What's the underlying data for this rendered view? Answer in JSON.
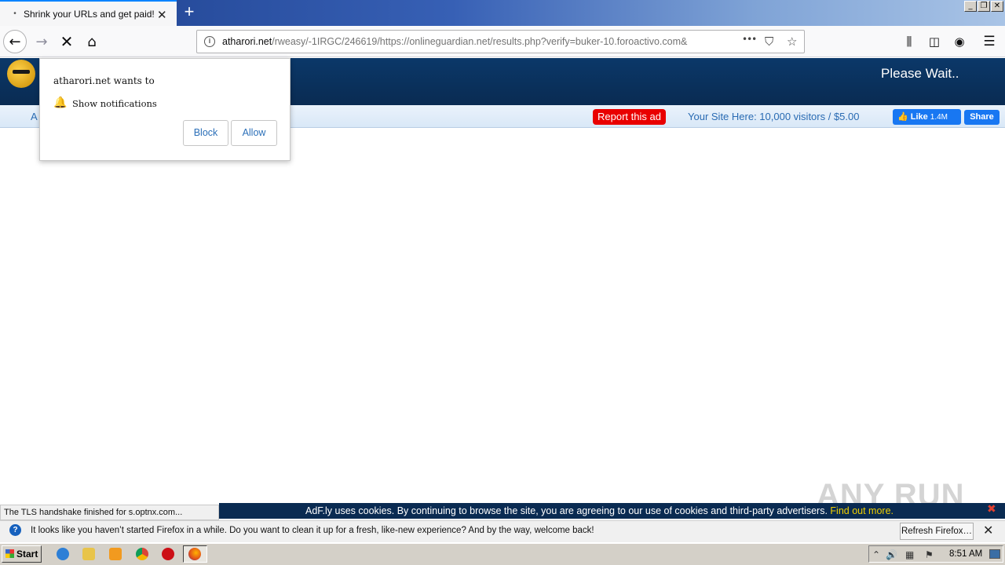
{
  "browser": {
    "tab_title": "Shrink your URLs and get paid!",
    "tab_favicon": "•",
    "tab_close": "✕",
    "new_tab": "+",
    "win_controls": [
      "_",
      "❐",
      "✕"
    ],
    "url_host": "atharori.net",
    "url_rest": "/rweasy/-1IRGC/246619/https://onlineguardian.net/results.php?verify=buker-10.foroactivo.com&",
    "url_menu": "•••"
  },
  "page": {
    "please_wait": "Please Wait..",
    "subbar_left": "A",
    "report_ad": "Report this ad",
    "your_site": "Your Site Here: 10,000 visitors / $5.00",
    "fb_like": "Like",
    "fb_like_count": "1.4M",
    "fb_share": "Share"
  },
  "popup": {
    "message": "atharori.net wants to",
    "permission": "Show notifications",
    "block": "Block",
    "allow": "Allow"
  },
  "status_text": "The TLS handshake finished for s.optnx.com...",
  "cookie": {
    "text": "AdF.ly uses cookies. By continuing to browse the site, you are agreeing to our use of cookies and third-party advertisers.",
    "link": "Find out more.",
    "close": "✖"
  },
  "watermark": "ANY RUN",
  "notification_bar": {
    "icon": "?",
    "text": "It looks like you haven’t started Firefox in a while. Do you want to clean it up for a fresh, like-new experience? And by the way, welcome back!",
    "button": "Refresh Firefox…",
    "close": "✕"
  },
  "taskbar": {
    "start": "Start",
    "clock": "8:51 AM"
  }
}
